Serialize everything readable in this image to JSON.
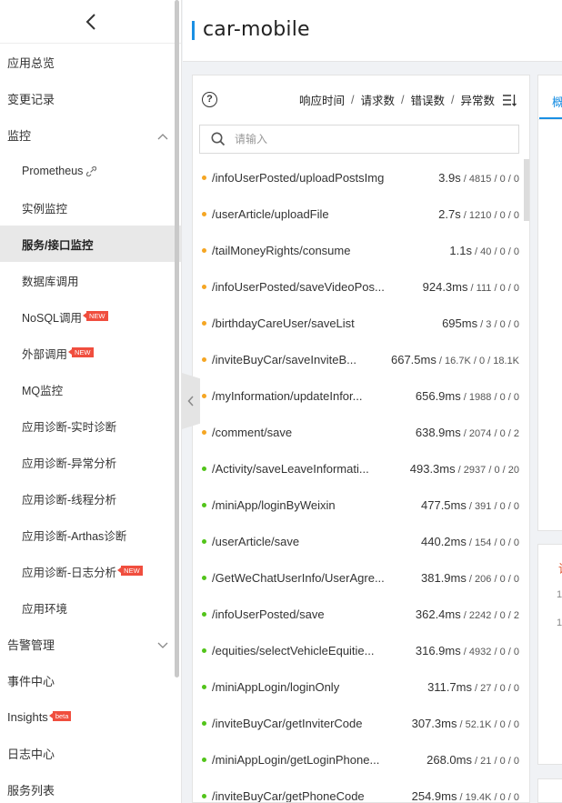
{
  "app": {
    "title": "car-mobile"
  },
  "sidebar": {
    "items": [
      {
        "label": "应用总览",
        "level": 0
      },
      {
        "label": "变更记录",
        "level": 0
      },
      {
        "label": "监控",
        "level": 0,
        "caret": "up"
      },
      {
        "label": "Prometheus",
        "level": 1,
        "icon": "link-icon"
      },
      {
        "label": "实例监控",
        "level": 1
      },
      {
        "label": "服务/接口监控",
        "level": 1,
        "active": true
      },
      {
        "label": "数据库调用",
        "level": 1
      },
      {
        "label": "NoSQL调用",
        "level": 1,
        "badge": "NEW"
      },
      {
        "label": "外部调用",
        "level": 1,
        "badge": "NEW"
      },
      {
        "label": "MQ监控",
        "level": 1
      },
      {
        "label": "应用诊断-实时诊断",
        "level": 1
      },
      {
        "label": "应用诊断-异常分析",
        "level": 1
      },
      {
        "label": "应用诊断-线程分析",
        "level": 1
      },
      {
        "label": "应用诊断-Arthas诊断",
        "level": 1
      },
      {
        "label": "应用诊断-日志分析",
        "level": 1,
        "badge": "NEW"
      },
      {
        "label": "应用环境",
        "level": 1
      },
      {
        "label": "告警管理",
        "level": 0,
        "caret": "down"
      },
      {
        "label": "事件中心",
        "level": 0
      },
      {
        "label": "Insights",
        "level": 0,
        "badge": "beta"
      },
      {
        "label": "日志中心",
        "level": 0
      },
      {
        "label": "服务列表",
        "level": 0
      }
    ]
  },
  "panel": {
    "metrics": {
      "response_time": "响应时间",
      "requests": "请求数",
      "errors": "错误数",
      "exceptions": "异常数",
      "separator": "/"
    },
    "search": {
      "placeholder": "请输入",
      "value": ""
    },
    "rows": [
      {
        "status": "orange",
        "path": "/infoUserPosted/uploadPostsImg",
        "time": "3.9s",
        "requests": "4815",
        "errors": "0",
        "exceptions": "0"
      },
      {
        "status": "orange",
        "path": "/userArticle/uploadFile",
        "time": "2.7s",
        "requests": "1210",
        "errors": "0",
        "exceptions": "0"
      },
      {
        "status": "orange",
        "path": "/tailMoneyRights/consume",
        "time": "1.1s",
        "requests": "40",
        "errors": "0",
        "exceptions": "0"
      },
      {
        "status": "orange",
        "path": "/infoUserPosted/saveVideoPos...",
        "time": "924.3ms",
        "requests": "111",
        "errors": "0",
        "exceptions": "0"
      },
      {
        "status": "orange",
        "path": "/birthdayCareUser/saveList",
        "time": "695ms",
        "requests": "3",
        "errors": "0",
        "exceptions": "0"
      },
      {
        "status": "orange",
        "path": "/inviteBuyCar/saveInviteB...",
        "time": "667.5ms",
        "requests": "16.7K",
        "errors": "0",
        "exceptions": "18.1K"
      },
      {
        "status": "orange",
        "path": "/myInformation/updateInfor...",
        "time": "656.9ms",
        "requests": "1988",
        "errors": "0",
        "exceptions": "0"
      },
      {
        "status": "orange",
        "path": "/comment/save",
        "time": "638.9ms",
        "requests": "2074",
        "errors": "0",
        "exceptions": "2"
      },
      {
        "status": "green",
        "path": "/Activity/saveLeaveInformati...",
        "time": "493.3ms",
        "requests": "2937",
        "errors": "0",
        "exceptions": "20"
      },
      {
        "status": "green",
        "path": "/miniApp/loginByWeixin",
        "time": "477.5ms",
        "requests": "391",
        "errors": "0",
        "exceptions": "0"
      },
      {
        "status": "green",
        "path": "/userArticle/save",
        "time": "440.2ms",
        "requests": "154",
        "errors": "0",
        "exceptions": "0"
      },
      {
        "status": "green",
        "path": "/GetWeChatUserInfo/UserAgre...",
        "time": "381.9ms",
        "requests": "206",
        "errors": "0",
        "exceptions": "0"
      },
      {
        "status": "green",
        "path": "/infoUserPosted/save",
        "time": "362.4ms",
        "requests": "2242",
        "errors": "0",
        "exceptions": "2"
      },
      {
        "status": "green",
        "path": "/equities/selectVehicleEquitie...",
        "time": "316.9ms",
        "requests": "4932",
        "errors": "0",
        "exceptions": "0"
      },
      {
        "status": "green",
        "path": "/miniAppLogin/loginOnly",
        "time": "311.7ms",
        "requests": "27",
        "errors": "0",
        "exceptions": "0"
      },
      {
        "status": "green",
        "path": "/inviteBuyCar/getInviterCode",
        "time": "307.3ms",
        "requests": "52.1K",
        "errors": "0",
        "exceptions": "0"
      },
      {
        "status": "green",
        "path": "/miniAppLogin/getLoginPhone...",
        "time": "268.0ms",
        "requests": "21",
        "errors": "0",
        "exceptions": "0"
      },
      {
        "status": "green",
        "path": "/inviteBuyCar/getPhoneCode",
        "time": "254.9ms",
        "requests": "19.4K",
        "errors": "0",
        "exceptions": "0"
      }
    ]
  },
  "right_panel": {
    "tab_label": "概",
    "section_title": "请",
    "line1": "1",
    "line2": "1"
  },
  "colors": {
    "accent": "#1a8fe3",
    "warning_dot": "#f5a623",
    "ok_dot": "#52c41a",
    "badge": "#f04e3e"
  }
}
